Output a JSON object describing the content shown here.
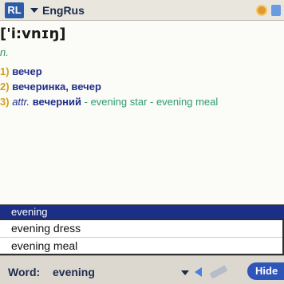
{
  "header": {
    "app_badge": "RL",
    "dictionary": "EngRus"
  },
  "entry": {
    "phonetic": "['i:vnɪŋ]",
    "part_of_speech": "n.",
    "senses": [
      {
        "num": "1)",
        "text": "вечер"
      },
      {
        "num": "2)",
        "text": "вечеринка, вечер"
      },
      {
        "num": "3)",
        "attr": "attr.",
        "text": "вечерний",
        "example": " - evening star - evening meal"
      }
    ]
  },
  "search": {
    "value": "evening"
  },
  "suggestions": [
    "evening dress",
    "evening meal"
  ],
  "toolbar": {
    "word_label": "Word:",
    "word_value": "evening",
    "hide_button": "Hide"
  }
}
